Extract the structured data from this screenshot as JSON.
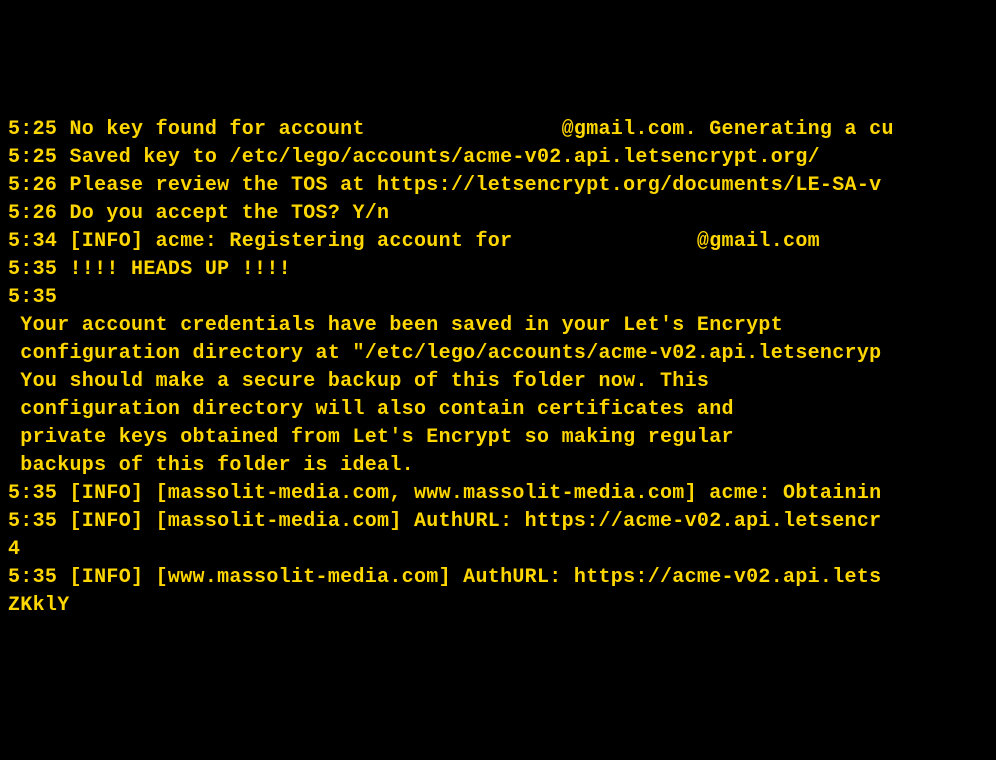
{
  "lines": {
    "l0": "5:25 No key found for account                @gmail.com. Generating a cu",
    "l1": "5:25 Saved key to /etc/lego/accounts/acme-v02.api.letsencrypt.org/",
    "l2": "",
    "l3": "5:26 Please review the TOS at https://letsencrypt.org/documents/LE-SA-v",
    "l4": "5:26 Do you accept the TOS? Y/n",
    "l5": "",
    "l6": "5:34 [INFO] acme: Registering account for               @gmail.com",
    "l7": "5:35 !!!! HEADS UP !!!!",
    "l8": "5:35",
    "l9": " Your account credentials have been saved in your Let's Encrypt",
    "l10": " configuration directory at \"/etc/lego/accounts/acme-v02.api.letsencryp",
    "l11": " You should make a secure backup of this folder now. This",
    "l12": " configuration directory will also contain certificates and",
    "l13": " private keys obtained from Let's Encrypt so making regular",
    "l14": " backups of this folder is ideal.",
    "l15": "5:35 [INFO] [massolit-media.com, www.massolit-media.com] acme: Obtainin",
    "l16": "5:35 [INFO] [massolit-media.com] AuthURL: https://acme-v02.api.letsencr",
    "l17": "4",
    "l18": "5:35 [INFO] [www.massolit-media.com] AuthURL: https://acme-v02.api.lets",
    "l19": "ZKklY"
  }
}
